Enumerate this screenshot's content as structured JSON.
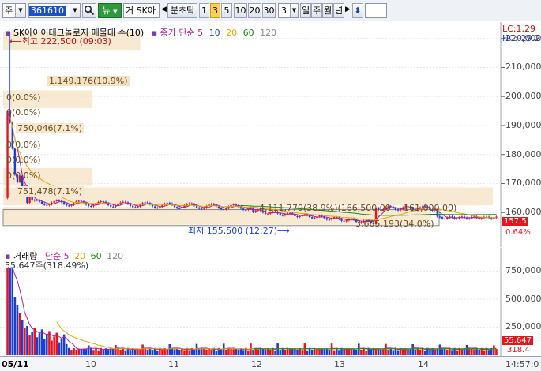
{
  "toolbar": {
    "market_label": "주",
    "code": "361610",
    "new_label": "뉴",
    "trade_label": "거",
    "name": "SK아",
    "period_label": "분초틱",
    "periods": [
      "1",
      "3",
      "5",
      "10",
      "20",
      "30"
    ],
    "active_period": "3",
    "unit_value": "3",
    "units": [
      "일",
      "주",
      "월",
      "년"
    ]
  },
  "price_pane": {
    "legend_title": "SK아이이테크놀로지 매물대 수(10)",
    "legend_ma_label": "종가 단순",
    "legend_ma_values": [
      "5",
      "10",
      "20",
      "60",
      "120"
    ],
    "high_label": "최고 222,500 (09:03)",
    "low_label": "최저 155,500 (12:27)",
    "profile": [
      {
        "label": "1,149,176(10.9%)"
      },
      {
        "label": "0(0.0%)"
      },
      {
        "label": "0(0.0%)"
      },
      {
        "label": "750,046(7.1%)"
      },
      {
        "label": "0(0.0%)"
      },
      {
        "label": "0(0.0%)"
      },
      {
        "label": "0(0.0%)"
      },
      {
        "label": "751,478(7.1%)"
      },
      {
        "label": "4,111,779(38.9%)(166,500.00 ~ 161,000.00)"
      },
      {
        "label": "3,605,193(34.0%)"
      }
    ],
    "lc_label": "LC:1.29",
    "hc_label": "HC:-29.2",
    "price_axis": [
      "220,000",
      "210,000",
      "200,000",
      "190,000",
      "180,000",
      "170,000",
      "160,000"
    ],
    "current_price": "157,5",
    "change_pct": "0.64%"
  },
  "volume_pane": {
    "legend_title": "거래량",
    "legend_ma_label": "단순",
    "legend_ma_values": [
      "5",
      "20",
      "60",
      "120"
    ],
    "max_label": "55,647주(318.49%)",
    "volume_axis": [
      "750,000",
      "500,000",
      "250,000"
    ],
    "current_volume": "55,647",
    "current_pct": "318.4"
  },
  "time_axis": {
    "labels": [
      "05/11",
      "10",
      "11",
      "12",
      "13",
      "14"
    ],
    "clock": "14:57:0"
  },
  "colors": {
    "up": "#e8141c",
    "down": "#1a3fd6",
    "ma5": "#b01ea0",
    "ma10": "#1a3fd6",
    "ma20": "#e0a800",
    "ma60": "#138a13",
    "ma120": "#888888",
    "profile": "#f5e1c4"
  },
  "chart_data": [
    {
      "type": "candlestick",
      "title": "SK아이이테크놀로지 매물대 수(10)",
      "ylim": [
        150000,
        224000
      ],
      "high": 222500,
      "low": 155500,
      "last": 157500,
      "y_ticks": [
        220000,
        210000,
        200000,
        190000,
        180000,
        170000,
        160000
      ],
      "x_labels": [
        "05/11",
        "10",
        "11",
        "12",
        "13",
        "14"
      ],
      "volume_profile": [
        {
          "volume": 1149176,
          "pct": 10.9
        },
        {
          "volume": 0,
          "pct": 0.0
        },
        {
          "volume": 0,
          "pct": 0.0
        },
        {
          "volume": 750046,
          "pct": 7.1
        },
        {
          "volume": 0,
          "pct": 0.0
        },
        {
          "volume": 0,
          "pct": 0.0
        },
        {
          "volume": 0,
          "pct": 0.0
        },
        {
          "volume": 751478,
          "pct": 7.1
        },
        {
          "volume": 4111779,
          "pct": 38.9
        },
        {
          "volume": 3605193,
          "pct": 34.0
        }
      ]
    },
    {
      "type": "bar",
      "title": "거래량",
      "ylim": [
        0,
        900000
      ],
      "y_ticks": [
        750000,
        500000,
        250000
      ],
      "last": 55647,
      "last_pct": 318.49
    }
  ]
}
